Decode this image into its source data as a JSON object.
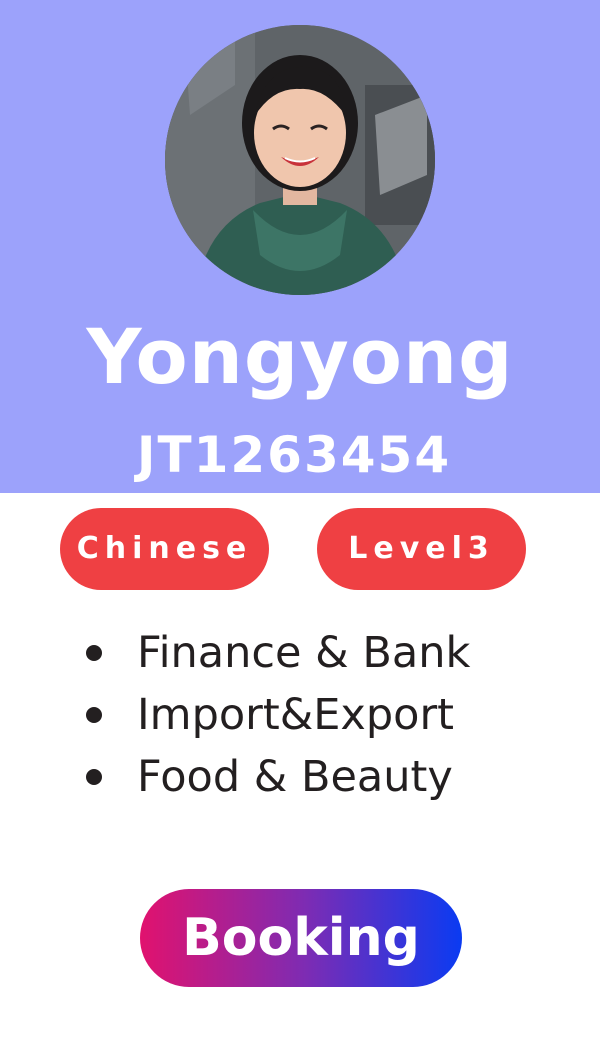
{
  "profile": {
    "name": "Yongyong",
    "agent_id": "JT1263454"
  },
  "tags": {
    "language": "Chinese",
    "level": "Level3"
  },
  "specialties": [
    "Finance & Bank",
    "Import&Export",
    "Food & Beauty"
  ],
  "actions": {
    "booking_label": "Booking"
  },
  "colors": {
    "header_background": "#9ca2fb",
    "pill_red": "#ef4043",
    "button_gradient_start": "#e1126e",
    "button_gradient_end": "#0a3bf2",
    "text_dark": "#231f20"
  }
}
